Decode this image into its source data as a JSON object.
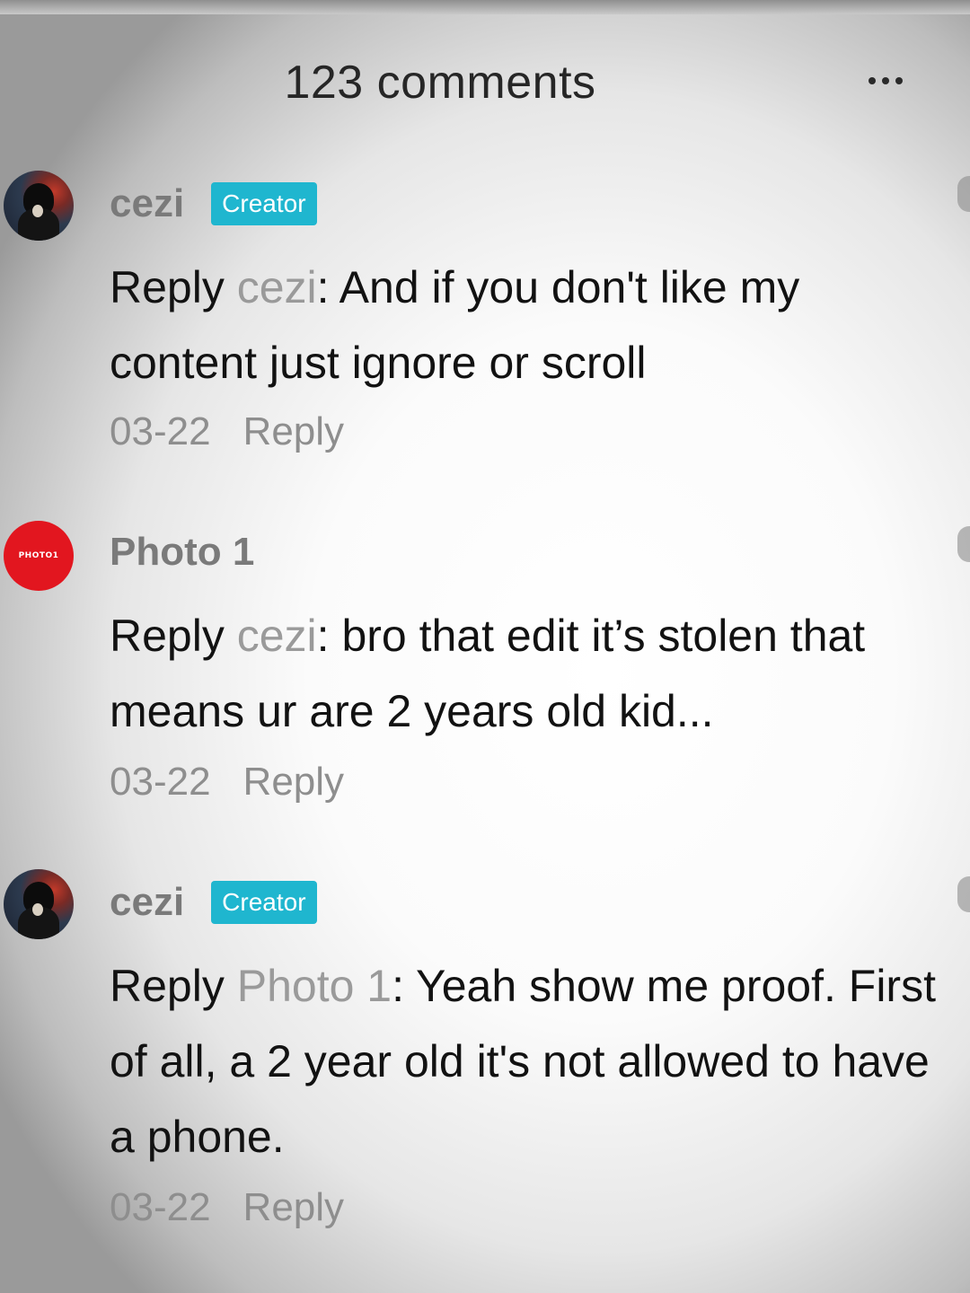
{
  "header": {
    "title": "123 comments",
    "more_icon": "ellipsis-icon"
  },
  "colors": {
    "creator_badge": "#1fb6cf",
    "username": "#7a7a7a",
    "reply_target": "#9a9a9a",
    "meta": "#8e8e8e",
    "photo_avatar": "#e2161f"
  },
  "comments": [
    {
      "username": "cezi",
      "badge": "Creator",
      "reply_prefix": "Reply ",
      "reply_target": "cezi",
      "text": ": And if you don't like my content just ignore or scroll",
      "date": "03-22",
      "reply_label": "Reply"
    },
    {
      "username": "Photo 1",
      "avatar_text": "PHOTO1",
      "reply_prefix": "Reply ",
      "reply_target": "cezi",
      "text": ": bro that edit it’s stolen that means ur are 2 years old kid...",
      "date": "03-22",
      "reply_label": "Reply"
    },
    {
      "username": "cezi",
      "badge": "Creator",
      "reply_prefix": "Reply ",
      "reply_target": "Photo 1",
      "text": ": Yeah show me proof. First of all, a 2 year old it's not allowed to have a phone.",
      "date": "03-22",
      "reply_label": "Reply"
    }
  ]
}
